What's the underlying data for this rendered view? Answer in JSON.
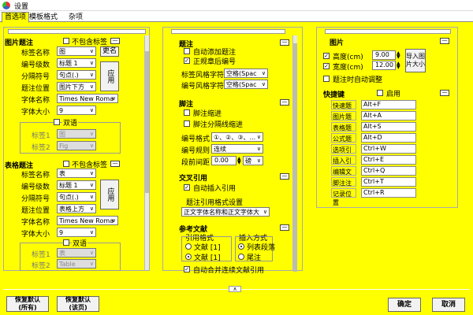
{
  "window": {
    "title": "设置"
  },
  "tabs": [
    "首选项",
    "模板格式",
    "杂项"
  ],
  "fig": {
    "title": "图片题注",
    "excl": "不包含标签",
    "tag_lbl": "标签名称",
    "tag": "图",
    "new": "更名",
    "level_lbl": "编号级数",
    "level": "标题 1",
    "sep_lbl": "分隔符号",
    "sep": "句点(.)",
    "apply": "应用",
    "pos_lbl": "题注位置",
    "pos": "图片下方",
    "font_lbl": "字体名称",
    "font": "Times New Roma",
    "size_lbl": "字体大小",
    "size": "9",
    "bi": "双语",
    "t1_lbl": "标签1",
    "t1": "图",
    "t2_lbl": "标签2",
    "t2": "Fig"
  },
  "tbl": {
    "title": "表格题注",
    "excl": "不包含标签",
    "tag_lbl": "标签名称",
    "tag": "表",
    "level_lbl": "编号级数",
    "level": "标题 1",
    "sep_lbl": "分隔符号",
    "sep": "句点(.)",
    "apply": "应用",
    "pos_lbl": "题注位置",
    "pos": "表格上方",
    "font_lbl": "字体名称",
    "font": "Times New Roma",
    "size_lbl": "字体大小",
    "size": "9",
    "bi": "双语",
    "t1_lbl": "标签1",
    "t1": "表",
    "t2_lbl": "标签2",
    "t2": "Table"
  },
  "cap": {
    "title": "题注",
    "auto": "自动添加题注",
    "norm": "正规章后编号",
    "tagstyle_lbl": "标签风格字符",
    "tagstyle": "空格(Spac",
    "numstyle_lbl": "编号风格字符",
    "numstyle": "空格(Spac"
  },
  "fn": {
    "title": "脚注",
    "indent": "脚注缩进",
    "sepindent": "脚注分隔线缩进",
    "fmt_lbl": "编号格式",
    "fmt": "①、②、③、...",
    "rule_lbl": "编号规则",
    "rule": "连续",
    "space_lbl": "段前间距",
    "space": "0.00",
    "unit": "磅"
  },
  "xref": {
    "title": "交叉引用",
    "auto": "自动插入引用",
    "fmt_lbl": "题注引用格式设置",
    "fmt": "正文字体名称和正文字体大"
  },
  "ref": {
    "title": "参考文献",
    "style_lbl": "引用格式",
    "s1": "文献 [1]",
    "s2": "文献 [1]",
    "ins_lbl": "插入方式",
    "i1": "列表段落",
    "i2": "尾注",
    "merge": "自动合并连续文献引用"
  },
  "pic": {
    "title": "图片",
    "h_lbl": "高度(cm)",
    "h": "9.00",
    "w_lbl": "宽度(cm)",
    "w": "12.00",
    "apply": "导入图片大小",
    "adj": "题注时自动调整"
  },
  "sc": {
    "title": "快捷键",
    "enable": "启用",
    "items": [
      {
        "n": "快速题注",
        "k": "Alt+F"
      },
      {
        "n": "图片题注",
        "k": "Alt+A"
      },
      {
        "n": "表格题注",
        "k": "Alt+S"
      },
      {
        "n": "公式题注",
        "k": "Alt+D"
      },
      {
        "n": "选项引用",
        "k": "Ctrl+W"
      },
      {
        "n": "插入引用",
        "k": "Ctrl+E"
      },
      {
        "n": "编辑文献",
        "k": "Ctrl+Q"
      },
      {
        "n": "脚注注释",
        "k": "Ctrl+T"
      },
      {
        "n": "记录位置",
        "k": "Ctrl+R"
      }
    ]
  },
  "footer": {
    "reset_all": "恢复默认\n(所有)",
    "reset_cur": "恢复默认\n(该页)",
    "ok": "确定",
    "cancel": "取消"
  },
  "glyphs": {
    "expand": "∧",
    "collapse": "—",
    "check": "✓",
    "arrow": "∨"
  }
}
